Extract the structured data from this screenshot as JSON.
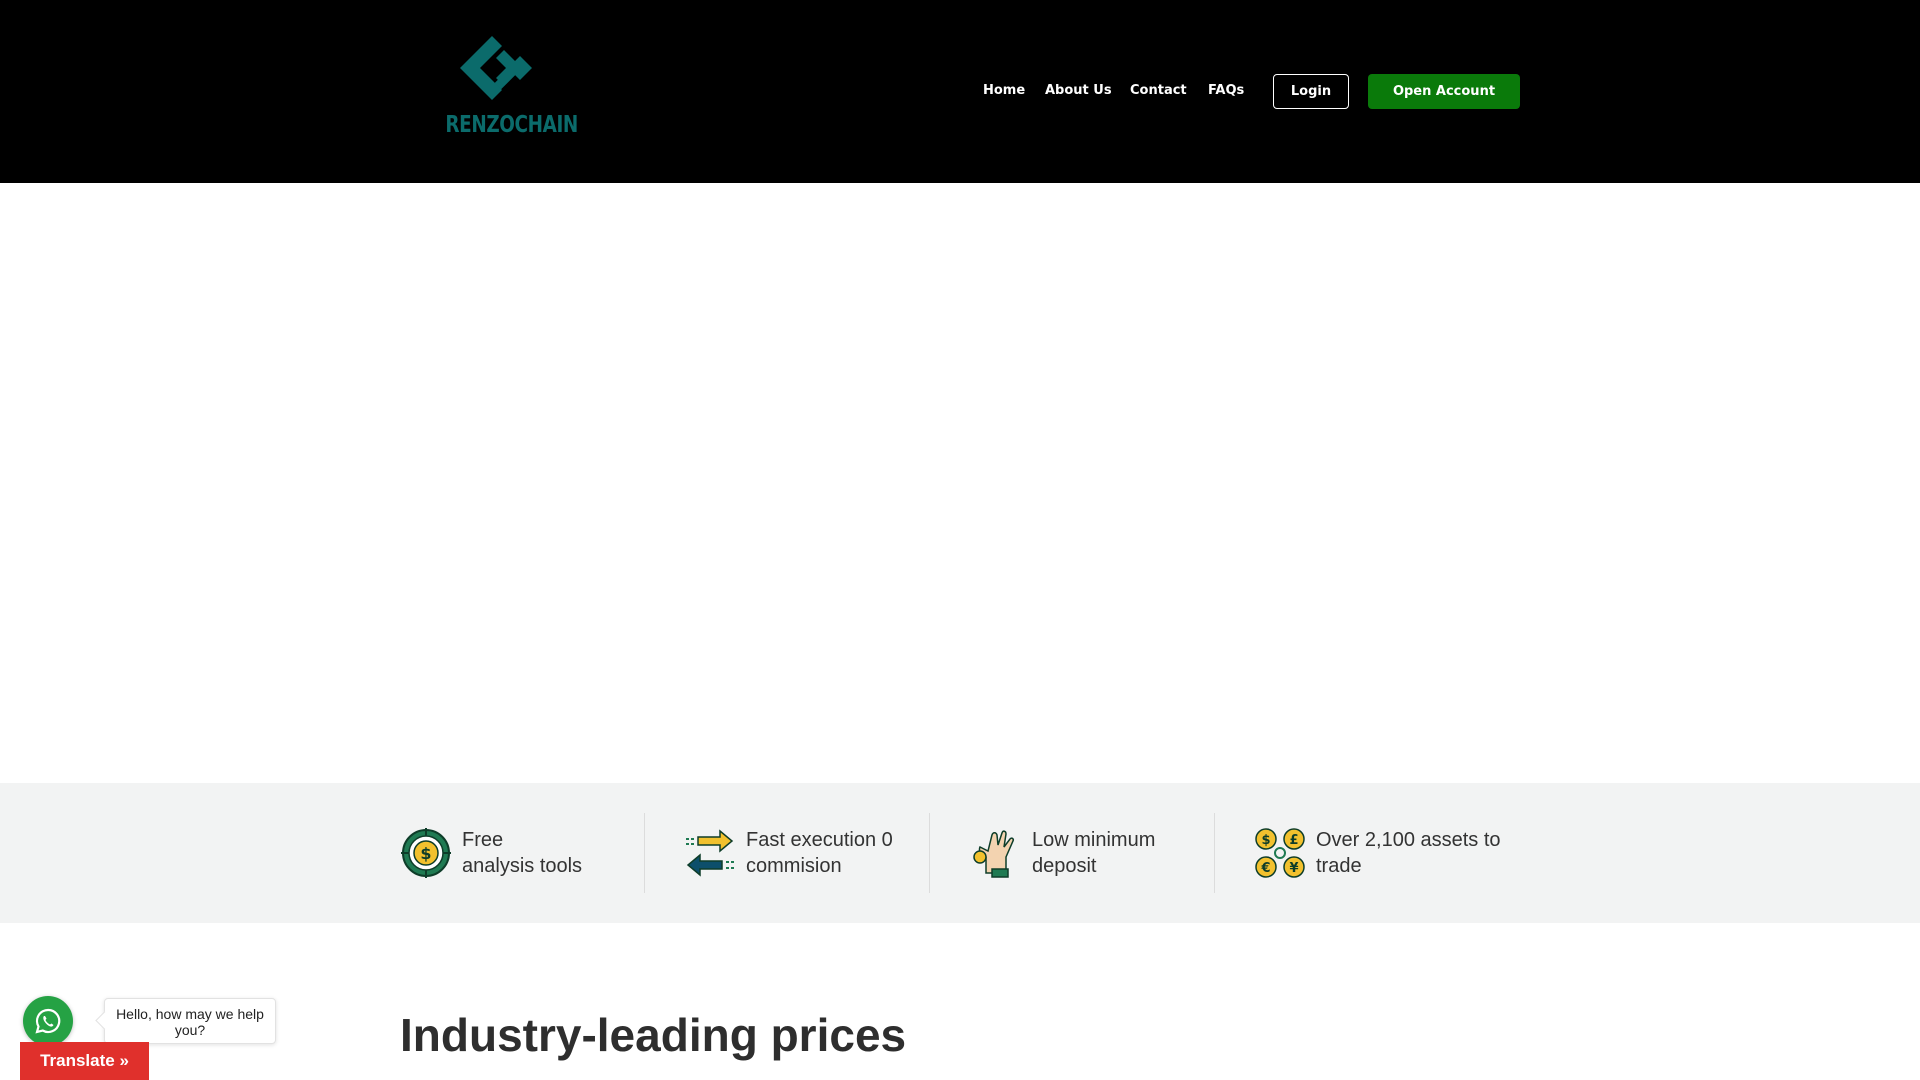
{
  "brand": {
    "name": "RENZOCHAIN",
    "logo_color": "#0b6b6b"
  },
  "nav": {
    "items": [
      {
        "label": "Home"
      },
      {
        "label": "About Us"
      },
      {
        "label": "Contact"
      },
      {
        "label": "FAQs"
      }
    ],
    "login_label": "Login",
    "open_account_label": "Open Account"
  },
  "colors": {
    "header_bg": "#000000",
    "accent_green": "#0a7a0a",
    "features_bg": "#f2f3f3",
    "translate_red": "#e0302c",
    "whatsapp_green": "#25a244"
  },
  "features": [
    {
      "line1": "Free",
      "line2": "analysis tools",
      "icon": "dollar-target-icon"
    },
    {
      "line1": "Fast execution 0",
      "line2": "commision",
      "icon": "exchange-arrows-icon"
    },
    {
      "line1": "Low minimum",
      "line2": "deposit",
      "icon": "hand-coin-icon"
    },
    {
      "line1": "Over 2,100 assets to",
      "line2": "trade",
      "icon": "currency-coins-icon"
    }
  ],
  "section": {
    "title": "Industry-leading prices"
  },
  "whatsapp": {
    "message": "Hello, how may we help you?"
  },
  "translate": {
    "label": "Translate »"
  }
}
